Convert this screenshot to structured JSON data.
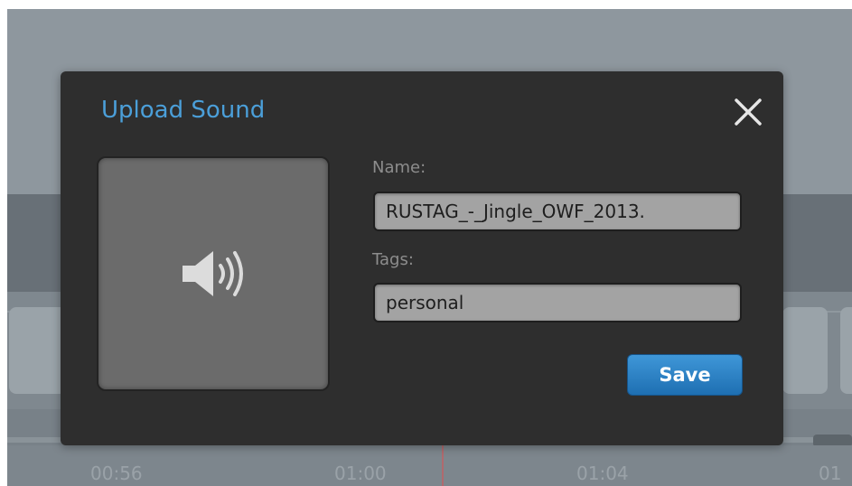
{
  "background": {
    "timeline_ticks": [
      "00:56",
      "01:00",
      "01:04",
      "01"
    ]
  },
  "modal": {
    "title": "Upload Sound",
    "close_icon": "close-icon",
    "preview_icon": "speaker-icon",
    "name_label": "Name:",
    "name_value": "RUSTAG_-_Jingle_OWF_2013.",
    "tags_label": "Tags:",
    "tags_value": "personal",
    "save_label": "Save"
  },
  "colors": {
    "title": "#4b9fd9",
    "save_button": "#2a82c8",
    "modal_bg": "#2e2e2e"
  }
}
